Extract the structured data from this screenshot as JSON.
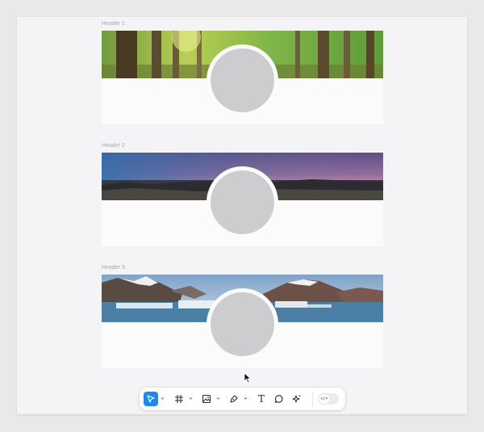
{
  "frames": [
    {
      "label": "Header 1",
      "image": "forest"
    },
    {
      "label": "Header 2",
      "image": "dusk-plains"
    },
    {
      "label": "Header 3",
      "image": "glacier-lagoon"
    }
  ],
  "toolbar": {
    "tools": [
      {
        "name": "move-tool",
        "icon": "cursor-arrow-icon",
        "active": true
      },
      {
        "name": "frame-tool",
        "icon": "hash-frame-icon",
        "active": false
      },
      {
        "name": "image-tool",
        "icon": "image-icon",
        "active": false
      },
      {
        "name": "pen-tool",
        "icon": "pen-nib-icon",
        "active": false
      },
      {
        "name": "text-tool",
        "icon": "text-icon",
        "active": false,
        "glyph": "T"
      },
      {
        "name": "comment-tool",
        "icon": "speech-bubble-icon",
        "active": false
      },
      {
        "name": "actions-tool",
        "icon": "sparkle-icon",
        "active": false
      }
    ],
    "code_glyph": "</>",
    "accent": "#1e88f2"
  }
}
